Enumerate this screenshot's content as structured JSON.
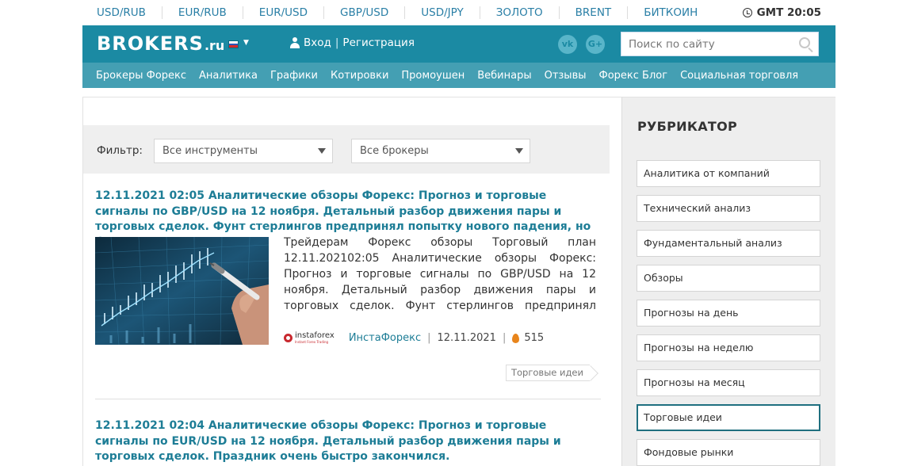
{
  "currency_bar": {
    "items": [
      "USD/RUB",
      "EUR/RUB",
      "EUR/USD",
      "GBP/USD",
      "USD/JPY",
      "ЗОЛОТО",
      "BRENT",
      "БИТКОИН"
    ],
    "time": "GMT 20:05"
  },
  "header": {
    "logo_main": "BROKERS",
    "logo_tld": ".ru",
    "login": "Вход",
    "register": "Регистрация",
    "social": [
      "vk",
      "G+"
    ],
    "search_placeholder": "Поиск по сайту",
    "colors": {
      "header_bg": "#1b8aa3",
      "nav_bg": "#449fb3",
      "link": "#1d7d96"
    }
  },
  "nav": {
    "items": [
      "Брокеры Форекс",
      "Аналитика",
      "Графики",
      "Котировки",
      "Промоушен",
      "Вебинары",
      "Отзывы",
      "Форекс Блог",
      "Социальная торговля"
    ]
  },
  "filter": {
    "label": "Фильтр:",
    "instrument": "Все инструменты",
    "broker": "Все брокеры"
  },
  "articles": [
    {
      "title": "12.11.2021 02:05 Аналитические обзоры Форекс: Прогноз и торговые сигналы по GBP/USD на 12 ноября. Детальный разбор движения пары и торговых сделок. Фунт стерлингов предпринял попытку нового падения, но быстро успокоился.",
      "text": "Трейдерам Форекс обзоры Торговый план 12.11.202102:05 Аналитические обзоры Форекс: Прогноз и торговые сигналы по GBP/USD на 12 ноября. Детальный разбор движения пары и торговых сделок. Фунт стерлингов предпринял попытку нового падения,",
      "broker_logo": "instaforex",
      "broker_logo_tag": "Instant Forex Trading",
      "author": "ИнстаФорекс",
      "date": "12.11.2021",
      "views": "515",
      "tag": "Торговые идеи"
    },
    {
      "title": "12.11.2021 02:04 Аналитические обзоры Форекс: Прогноз и торговые сигналы по EUR/USD на 12 ноября. Детальный разбор движения пары и торговых сделок. Праздник очень быстро закончился."
    }
  ],
  "sidebar": {
    "title": "РУБРИКАТОР",
    "items": [
      "Аналитика от компаний",
      "Технический анализ",
      "Фундаментальный анализ",
      "Обзоры",
      "Прогнозы на день",
      "Прогнозы на неделю",
      "Прогнозы на месяц",
      "Торговые идеи",
      "Фондовые рынки"
    ],
    "active_index": 7
  }
}
